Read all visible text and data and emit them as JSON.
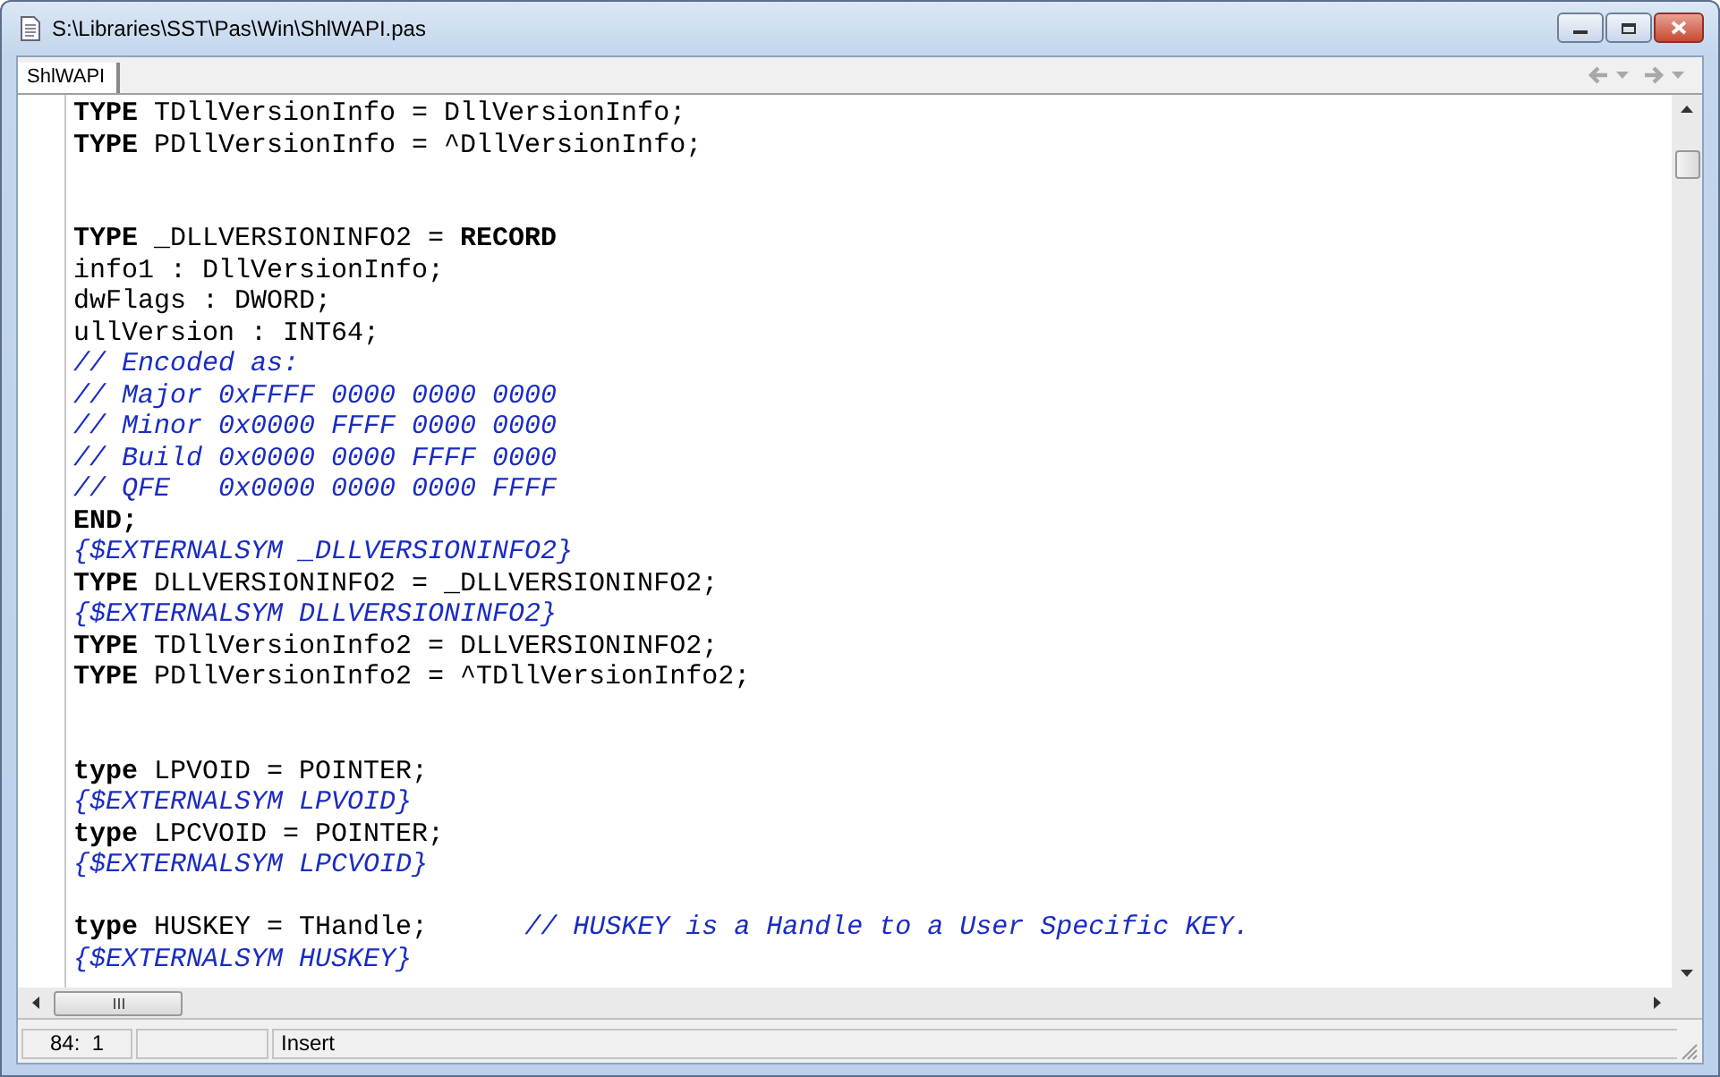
{
  "window": {
    "title": "S:\\Libraries\\SST\\Pas\\Win\\ShlWAPI.pas"
  },
  "tabs": [
    {
      "label": "ShlWAPI",
      "selected": true
    }
  ],
  "navigation": {
    "back_enabled": false,
    "forward_enabled": false
  },
  "editor": {
    "lines": [
      {
        "spans": [
          {
            "kind": "keyword",
            "text": "TYPE"
          },
          {
            "kind": "plain",
            "text": " TDllVersionInfo = DllVersionInfo;"
          }
        ]
      },
      {
        "spans": [
          {
            "kind": "keyword",
            "text": "TYPE"
          },
          {
            "kind": "plain",
            "text": " PDllVersionInfo = ^DllVersionInfo;"
          }
        ]
      },
      {
        "kind": "blank"
      },
      {
        "kind": "blank"
      },
      {
        "spans": [
          {
            "kind": "keyword",
            "text": "TYPE"
          },
          {
            "kind": "plain",
            "text": " _DLLVERSIONINFO2 = "
          },
          {
            "kind": "keyword",
            "text": "RECORD"
          }
        ]
      },
      {
        "spans": [
          {
            "kind": "plain",
            "text": "info1 : DllVersionInfo;"
          }
        ]
      },
      {
        "spans": [
          {
            "kind": "plain",
            "text": "dwFlags : DWORD;"
          }
        ]
      },
      {
        "spans": [
          {
            "kind": "plain",
            "text": "ullVersion : INT64;"
          }
        ]
      },
      {
        "spans": [
          {
            "kind": "comment",
            "text": "// Encoded as:"
          }
        ]
      },
      {
        "spans": [
          {
            "kind": "comment",
            "text": "// Major 0xFFFF 0000 0000 0000"
          }
        ]
      },
      {
        "spans": [
          {
            "kind": "comment",
            "text": "// Minor 0x0000 FFFF 0000 0000"
          }
        ]
      },
      {
        "spans": [
          {
            "kind": "comment",
            "text": "// Build 0x0000 0000 FFFF 0000"
          }
        ]
      },
      {
        "spans": [
          {
            "kind": "comment",
            "text": "// QFE   0x0000 0000 0000 FFFF"
          }
        ]
      },
      {
        "spans": [
          {
            "kind": "keyword",
            "text": "END;"
          }
        ]
      },
      {
        "spans": [
          {
            "kind": "comment",
            "text": "{$EXTERNALSYM _DLLVERSIONINFO2}"
          }
        ]
      },
      {
        "spans": [
          {
            "kind": "keyword",
            "text": "TYPE"
          },
          {
            "kind": "plain",
            "text": " DLLVERSIONINFO2 = _DLLVERSIONINFO2;"
          }
        ]
      },
      {
        "spans": [
          {
            "kind": "comment",
            "text": "{$EXTERNALSYM DLLVERSIONINFO2}"
          }
        ]
      },
      {
        "spans": [
          {
            "kind": "keyword",
            "text": "TYPE"
          },
          {
            "kind": "plain",
            "text": " TDllVersionInfo2 = DLLVERSIONINFO2;"
          }
        ]
      },
      {
        "spans": [
          {
            "kind": "keyword",
            "text": "TYPE"
          },
          {
            "kind": "plain",
            "text": " PDllVersionInfo2 = ^TDllVersionInfo2;"
          }
        ]
      },
      {
        "kind": "blank"
      },
      {
        "kind": "blank"
      },
      {
        "spans": [
          {
            "kind": "keyword",
            "text": "type"
          },
          {
            "kind": "plain",
            "text": " LPVOID = POINTER;"
          }
        ]
      },
      {
        "spans": [
          {
            "kind": "comment",
            "text": "{$EXTERNALSYM LPVOID}"
          }
        ]
      },
      {
        "spans": [
          {
            "kind": "keyword",
            "text": "type"
          },
          {
            "kind": "plain",
            "text": " LPCVOID = POINTER;"
          }
        ]
      },
      {
        "spans": [
          {
            "kind": "comment",
            "text": "{$EXTERNALSYM LPCVOID}"
          }
        ]
      },
      {
        "kind": "blank"
      },
      {
        "spans": [
          {
            "kind": "keyword",
            "text": "type"
          },
          {
            "kind": "plain",
            "text": " HUSKEY = THandle;      "
          },
          {
            "kind": "comment",
            "text": "// HUSKEY is a Handle to a User Specific KEY."
          }
        ]
      },
      {
        "spans": [
          {
            "kind": "comment",
            "text": "{$EXTERNALSYM HUSKEY}"
          }
        ]
      }
    ]
  },
  "status_bar": {
    "position": "84:  1",
    "mode": "Insert"
  }
}
